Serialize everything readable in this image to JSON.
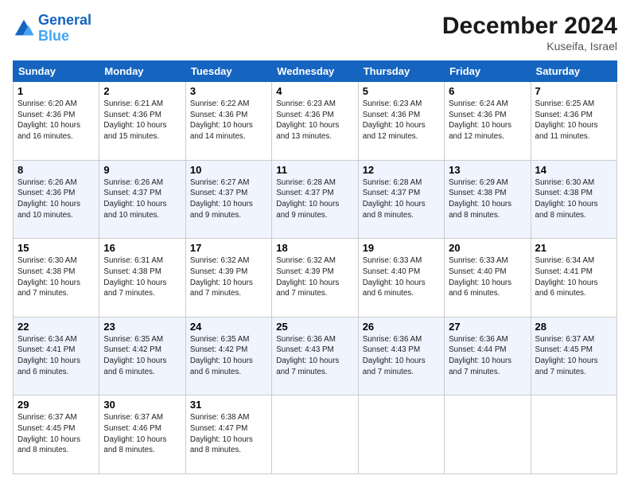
{
  "logo": {
    "line1": "General",
    "line2": "Blue"
  },
  "title": "December 2024",
  "subtitle": "Kuseifa, Israel",
  "days_of_week": [
    "Sunday",
    "Monday",
    "Tuesday",
    "Wednesday",
    "Thursday",
    "Friday",
    "Saturday"
  ],
  "weeks": [
    [
      {
        "day": "1",
        "sunrise": "6:20 AM",
        "sunset": "4:36 PM",
        "daylight": "10 hours and 16 minutes."
      },
      {
        "day": "2",
        "sunrise": "6:21 AM",
        "sunset": "4:36 PM",
        "daylight": "10 hours and 15 minutes."
      },
      {
        "day": "3",
        "sunrise": "6:22 AM",
        "sunset": "4:36 PM",
        "daylight": "10 hours and 14 minutes."
      },
      {
        "day": "4",
        "sunrise": "6:23 AM",
        "sunset": "4:36 PM",
        "daylight": "10 hours and 13 minutes."
      },
      {
        "day": "5",
        "sunrise": "6:23 AM",
        "sunset": "4:36 PM",
        "daylight": "10 hours and 12 minutes."
      },
      {
        "day": "6",
        "sunrise": "6:24 AM",
        "sunset": "4:36 PM",
        "daylight": "10 hours and 12 minutes."
      },
      {
        "day": "7",
        "sunrise": "6:25 AM",
        "sunset": "4:36 PM",
        "daylight": "10 hours and 11 minutes."
      }
    ],
    [
      {
        "day": "8",
        "sunrise": "6:26 AM",
        "sunset": "4:36 PM",
        "daylight": "10 hours and 10 minutes."
      },
      {
        "day": "9",
        "sunrise": "6:26 AM",
        "sunset": "4:37 PM",
        "daylight": "10 hours and 10 minutes."
      },
      {
        "day": "10",
        "sunrise": "6:27 AM",
        "sunset": "4:37 PM",
        "daylight": "10 hours and 9 minutes."
      },
      {
        "day": "11",
        "sunrise": "6:28 AM",
        "sunset": "4:37 PM",
        "daylight": "10 hours and 9 minutes."
      },
      {
        "day": "12",
        "sunrise": "6:28 AM",
        "sunset": "4:37 PM",
        "daylight": "10 hours and 8 minutes."
      },
      {
        "day": "13",
        "sunrise": "6:29 AM",
        "sunset": "4:38 PM",
        "daylight": "10 hours and 8 minutes."
      },
      {
        "day": "14",
        "sunrise": "6:30 AM",
        "sunset": "4:38 PM",
        "daylight": "10 hours and 8 minutes."
      }
    ],
    [
      {
        "day": "15",
        "sunrise": "6:30 AM",
        "sunset": "4:38 PM",
        "daylight": "10 hours and 7 minutes."
      },
      {
        "day": "16",
        "sunrise": "6:31 AM",
        "sunset": "4:38 PM",
        "daylight": "10 hours and 7 minutes."
      },
      {
        "day": "17",
        "sunrise": "6:32 AM",
        "sunset": "4:39 PM",
        "daylight": "10 hours and 7 minutes."
      },
      {
        "day": "18",
        "sunrise": "6:32 AM",
        "sunset": "4:39 PM",
        "daylight": "10 hours and 7 minutes."
      },
      {
        "day": "19",
        "sunrise": "6:33 AM",
        "sunset": "4:40 PM",
        "daylight": "10 hours and 6 minutes."
      },
      {
        "day": "20",
        "sunrise": "6:33 AM",
        "sunset": "4:40 PM",
        "daylight": "10 hours and 6 minutes."
      },
      {
        "day": "21",
        "sunrise": "6:34 AM",
        "sunset": "4:41 PM",
        "daylight": "10 hours and 6 minutes."
      }
    ],
    [
      {
        "day": "22",
        "sunrise": "6:34 AM",
        "sunset": "4:41 PM",
        "daylight": "10 hours and 6 minutes."
      },
      {
        "day": "23",
        "sunrise": "6:35 AM",
        "sunset": "4:42 PM",
        "daylight": "10 hours and 6 minutes."
      },
      {
        "day": "24",
        "sunrise": "6:35 AM",
        "sunset": "4:42 PM",
        "daylight": "10 hours and 6 minutes."
      },
      {
        "day": "25",
        "sunrise": "6:36 AM",
        "sunset": "4:43 PM",
        "daylight": "10 hours and 7 minutes."
      },
      {
        "day": "26",
        "sunrise": "6:36 AM",
        "sunset": "4:43 PM",
        "daylight": "10 hours and 7 minutes."
      },
      {
        "day": "27",
        "sunrise": "6:36 AM",
        "sunset": "4:44 PM",
        "daylight": "10 hours and 7 minutes."
      },
      {
        "day": "28",
        "sunrise": "6:37 AM",
        "sunset": "4:45 PM",
        "daylight": "10 hours and 7 minutes."
      }
    ],
    [
      {
        "day": "29",
        "sunrise": "6:37 AM",
        "sunset": "4:45 PM",
        "daylight": "10 hours and 8 minutes."
      },
      {
        "day": "30",
        "sunrise": "6:37 AM",
        "sunset": "4:46 PM",
        "daylight": "10 hours and 8 minutes."
      },
      {
        "day": "31",
        "sunrise": "6:38 AM",
        "sunset": "4:47 PM",
        "daylight": "10 hours and 8 minutes."
      },
      null,
      null,
      null,
      null
    ]
  ]
}
